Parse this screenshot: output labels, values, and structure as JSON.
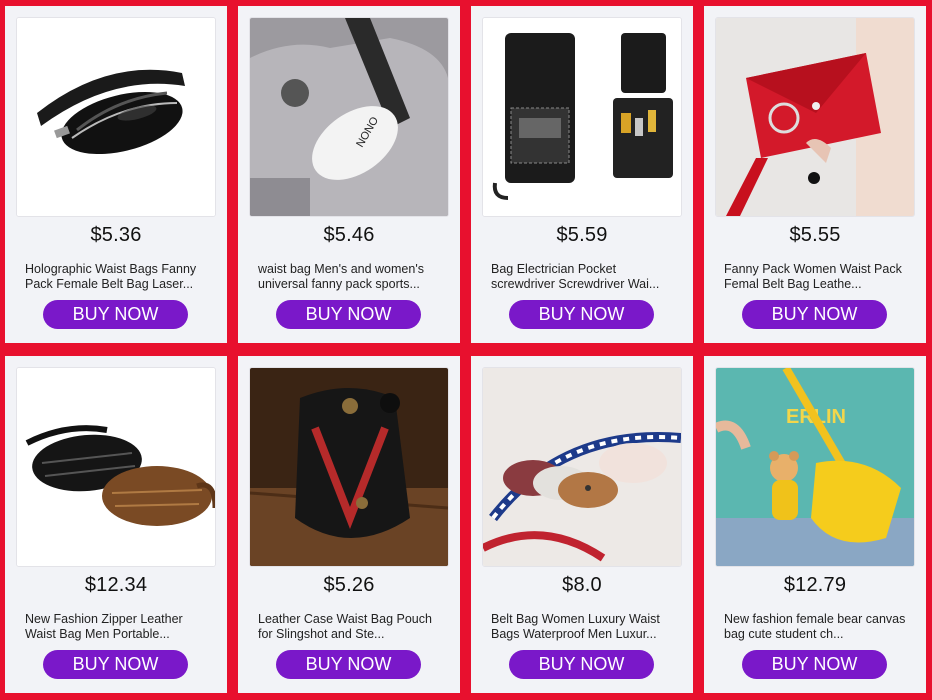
{
  "products": [
    {
      "price": "$5.36",
      "title": "Holographic Waist Bags Fanny Pack Female Belt Bag Laser...",
      "button": "BUY NOW",
      "image": "black-glossy-waist-bag"
    },
    {
      "price": "$5.46",
      "title": "waist bag Men's and women's universal fanny pack sports...",
      "button": "BUY NOW",
      "image": "white-nono-chest-bag"
    },
    {
      "price": "$5.59",
      "title": "Bag Electrician Pocket screwdriver Screwdriver Wai...",
      "button": "BUY NOW",
      "image": "electrician-tool-pouch"
    },
    {
      "price": "$5.55",
      "title": "Fanny Pack Women Waist Pack Femal Belt Bag Leathe...",
      "button": "BUY NOW",
      "image": "red-envelope-ring-bag"
    },
    {
      "price": "$12.34",
      "title": "New Fashion Zipper Leather Waist Bag Men Portable...",
      "button": "BUY NOW",
      "image": "black-brown-leather-waist-bags"
    },
    {
      "price": "$5.26",
      "title": "Leather Case Waist Bag Pouch for Slingshot and Ste...",
      "button": "BUY NOW",
      "image": "leather-slingshot-pouch"
    },
    {
      "price": "$8.0",
      "title": "Belt Bag Women Luxury Waist Bags Waterproof Men Luxur...",
      "button": "BUY NOW",
      "image": "striped-strap-belt-bags"
    },
    {
      "price": "$12.79",
      "title": "New fashion female bear canvas bag cute student ch...",
      "button": "BUY NOW",
      "image": "yellow-bear-canvas-bag"
    }
  ],
  "colors": {
    "background": "#e8102e",
    "card": "#f2f3f7",
    "button": "#7a18c9"
  }
}
